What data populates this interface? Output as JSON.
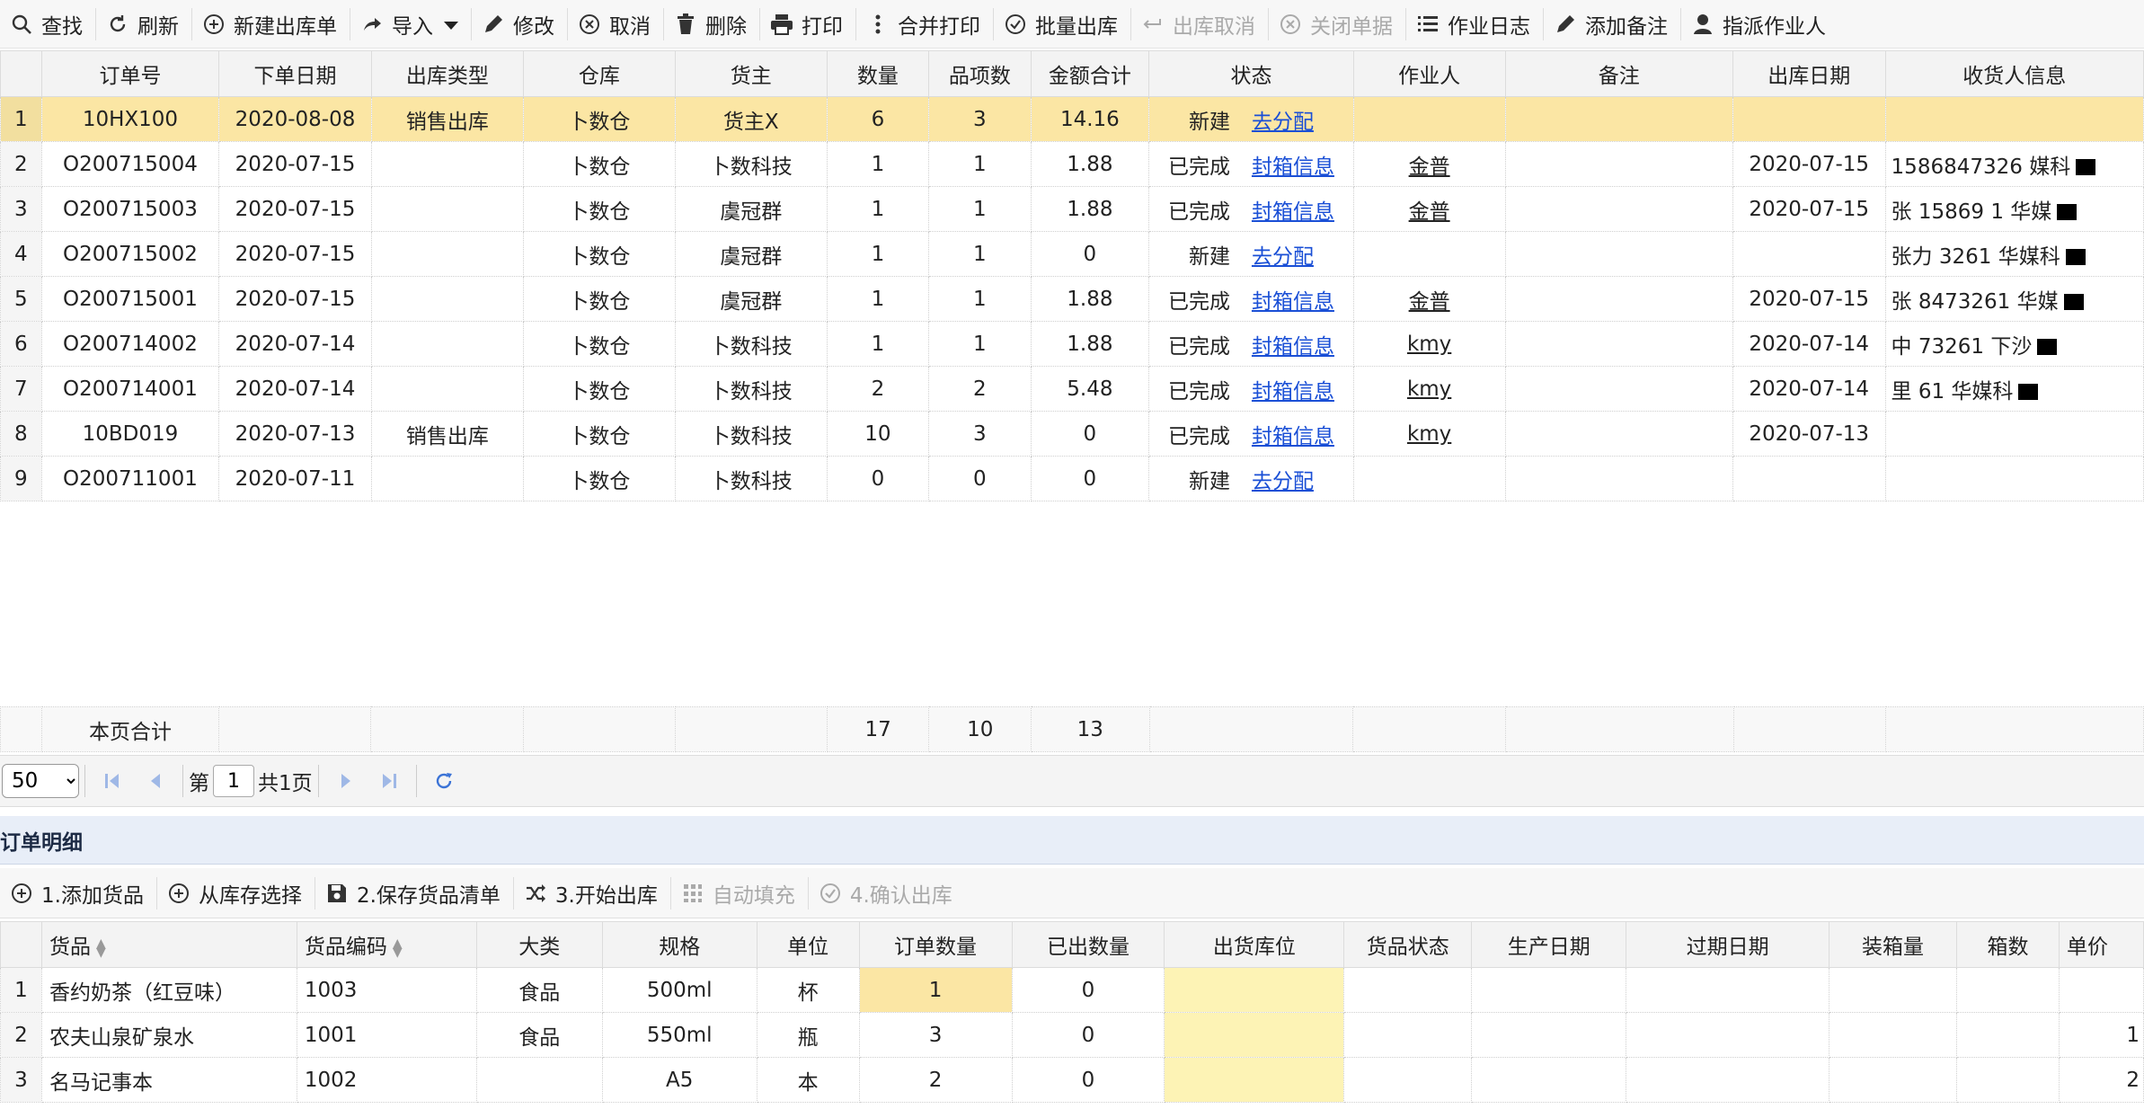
{
  "toolbar": {
    "search": "查找",
    "refresh": "刷新",
    "new_order": "新建出库单",
    "import": "导入",
    "edit": "修改",
    "cancel": "取消",
    "delete": "删除",
    "print": "打印",
    "merge_print": "合并打印",
    "batch_out": "批量出库",
    "cancel_out": "出库取消",
    "close_doc": "关闭单据",
    "work_log": "作业日志",
    "add_note": "添加备注",
    "assign_operator": "指派作业人"
  },
  "main_grid": {
    "columns": [
      "订单号",
      "下单日期",
      "出库类型",
      "仓库",
      "货主",
      "数量",
      "品项数",
      "金额合计",
      "状态",
      "作业人",
      "备注",
      "出库日期",
      "收货人信息"
    ],
    "rows": [
      {
        "no": "1",
        "order": "10HX100",
        "date": "2020-08-08",
        "type": "销售出库",
        "wh": "卜数仓",
        "owner": "货主X",
        "qty": "6",
        "items": "3",
        "amount": "14.16",
        "status": "新建",
        "action": "去分配",
        "operator": "",
        "note": "",
        "out_date": "",
        "consignee": ""
      },
      {
        "no": "2",
        "order": "O200715004",
        "date": "2020-07-15",
        "type": "",
        "wh": "卜数仓",
        "owner": "卜数科技",
        "qty": "1",
        "items": "1",
        "amount": "1.88",
        "status": "已完成",
        "action": "封箱信息",
        "operator": "金普",
        "note": "",
        "out_date": "2020-07-15",
        "consignee": "1586847326 媒科"
      },
      {
        "no": "3",
        "order": "O200715003",
        "date": "2020-07-15",
        "type": "",
        "wh": "卜数仓",
        "owner": "虞冠群",
        "qty": "1",
        "items": "1",
        "amount": "1.88",
        "status": "已完成",
        "action": "封箱信息",
        "operator": "金普",
        "note": "",
        "out_date": "2020-07-15",
        "consignee": "张 15869 1 华媒"
      },
      {
        "no": "4",
        "order": "O200715002",
        "date": "2020-07-15",
        "type": "",
        "wh": "卜数仓",
        "owner": "虞冠群",
        "qty": "1",
        "items": "1",
        "amount": "0",
        "status": "新建",
        "action": "去分配",
        "operator": "",
        "note": "",
        "out_date": "",
        "consignee": "张力 3261 华媒科"
      },
      {
        "no": "5",
        "order": "O200715001",
        "date": "2020-07-15",
        "type": "",
        "wh": "卜数仓",
        "owner": "虞冠群",
        "qty": "1",
        "items": "1",
        "amount": "1.88",
        "status": "已完成",
        "action": "封箱信息",
        "operator": "金普",
        "note": "",
        "out_date": "2020-07-15",
        "consignee": "张 8473261 华媒"
      },
      {
        "no": "6",
        "order": "O200714002",
        "date": "2020-07-14",
        "type": "",
        "wh": "卜数仓",
        "owner": "卜数科技",
        "qty": "1",
        "items": "1",
        "amount": "1.88",
        "status": "已完成",
        "action": "封箱信息",
        "operator": "kmy",
        "note": "",
        "out_date": "2020-07-14",
        "consignee": "中 73261 下沙"
      },
      {
        "no": "7",
        "order": "O200714001",
        "date": "2020-07-14",
        "type": "",
        "wh": "卜数仓",
        "owner": "卜数科技",
        "qty": "2",
        "items": "2",
        "amount": "5.48",
        "status": "已完成",
        "action": "封箱信息",
        "operator": "kmy",
        "note": "",
        "out_date": "2020-07-14",
        "consignee": "里 61 华媒科"
      },
      {
        "no": "8",
        "order": "10BD019",
        "date": "2020-07-13",
        "type": "销售出库",
        "wh": "卜数仓",
        "owner": "卜数科技",
        "qty": "10",
        "items": "3",
        "amount": "0",
        "status": "已完成",
        "action": "封箱信息",
        "operator": "kmy",
        "note": "",
        "out_date": "2020-07-13",
        "consignee": ""
      },
      {
        "no": "9",
        "order": "O200711001",
        "date": "2020-07-11",
        "type": "",
        "wh": "卜数仓",
        "owner": "卜数科技",
        "qty": "0",
        "items": "0",
        "amount": "0",
        "status": "新建",
        "action": "去分配",
        "operator": "",
        "note": "",
        "out_date": "",
        "consignee": ""
      }
    ],
    "summary": {
      "label": "本页合计",
      "qty": "17",
      "items": "10",
      "amount": "13"
    }
  },
  "pager": {
    "page_size": "50",
    "page_size_options": [
      "50"
    ],
    "page_prefix": "第",
    "page_current": "1",
    "page_total": "共1页"
  },
  "detail": {
    "title": "订单明细",
    "toolbar": {
      "add_goods": "1.添加货品",
      "from_stock": "从库存选择",
      "save_list": "2.保存货品清单",
      "start_out": "3.开始出库",
      "auto_fill": "自动填充",
      "confirm_out": "4.确认出库"
    },
    "columns": [
      "货品",
      "货品编码",
      "大类",
      "规格",
      "单位",
      "订单数量",
      "已出数量",
      "出货库位",
      "货品状态",
      "生产日期",
      "过期日期",
      "装箱量",
      "箱数",
      "单价"
    ],
    "rows": [
      {
        "no": "1",
        "goods": "香约奶茶（红豆味）",
        "code": "1003",
        "cat": "食品",
        "spec": "500ml",
        "unit": "杯",
        "ord": "1",
        "out": "0",
        "price": ""
      },
      {
        "no": "2",
        "goods": "农夫山泉矿泉水",
        "code": "1001",
        "cat": "食品",
        "spec": "550ml",
        "unit": "瓶",
        "ord": "3",
        "out": "0",
        "price": "1"
      },
      {
        "no": "3",
        "goods": "名马记事本",
        "code": "1002",
        "cat": "",
        "spec": "A5",
        "unit": "本",
        "ord": "2",
        "out": "0",
        "price": "2"
      }
    ]
  },
  "colors": {
    "selected_row": "#fbe6a4",
    "link": "#1a4fd6",
    "location_highlight": "#fdf3b5",
    "detail_header": "#e8eef8"
  }
}
